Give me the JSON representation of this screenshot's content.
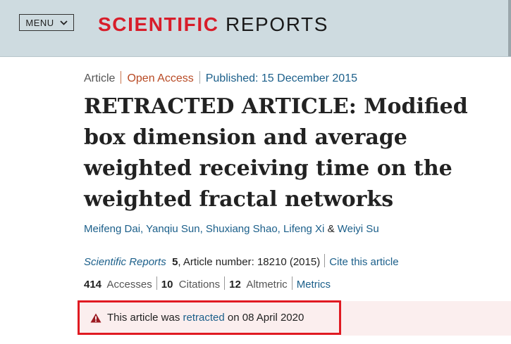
{
  "header": {
    "menu_label": "MENU",
    "logo_part1": "SCIENTIFIC",
    "logo_part2": "REPORTS",
    "brand_color": "#d81d2a"
  },
  "article": {
    "type": "Article",
    "access": "Open Access",
    "published": "Published: 15 December 2015",
    "title": "RETRACTED ARTICLE: Modified box dimension and average weighted receiving time on the weighted fractal networks",
    "authors": [
      "Meifeng Dai",
      "Yanqiu Sun",
      "Shuxiang Shao",
      "Lifeng Xi"
    ],
    "last_author": "Weiyi Su",
    "journal": "Scientific Reports",
    "volume": "5",
    "article_number": ", Article number: 18210 (2015)",
    "cite_label": "Cite this article"
  },
  "metrics": {
    "accesses_count": "414",
    "accesses_label": "Accesses",
    "citations_count": "10",
    "citations_label": "Citations",
    "altmetric_count": "12",
    "altmetric_label": "Altmetric",
    "metrics_link": "Metrics"
  },
  "notice": {
    "icon": "warning-triangle-icon",
    "text_before": "This article was",
    "link": "retracted",
    "text_after": "on 08 April 2020",
    "highlight_color": "#e01a22"
  }
}
